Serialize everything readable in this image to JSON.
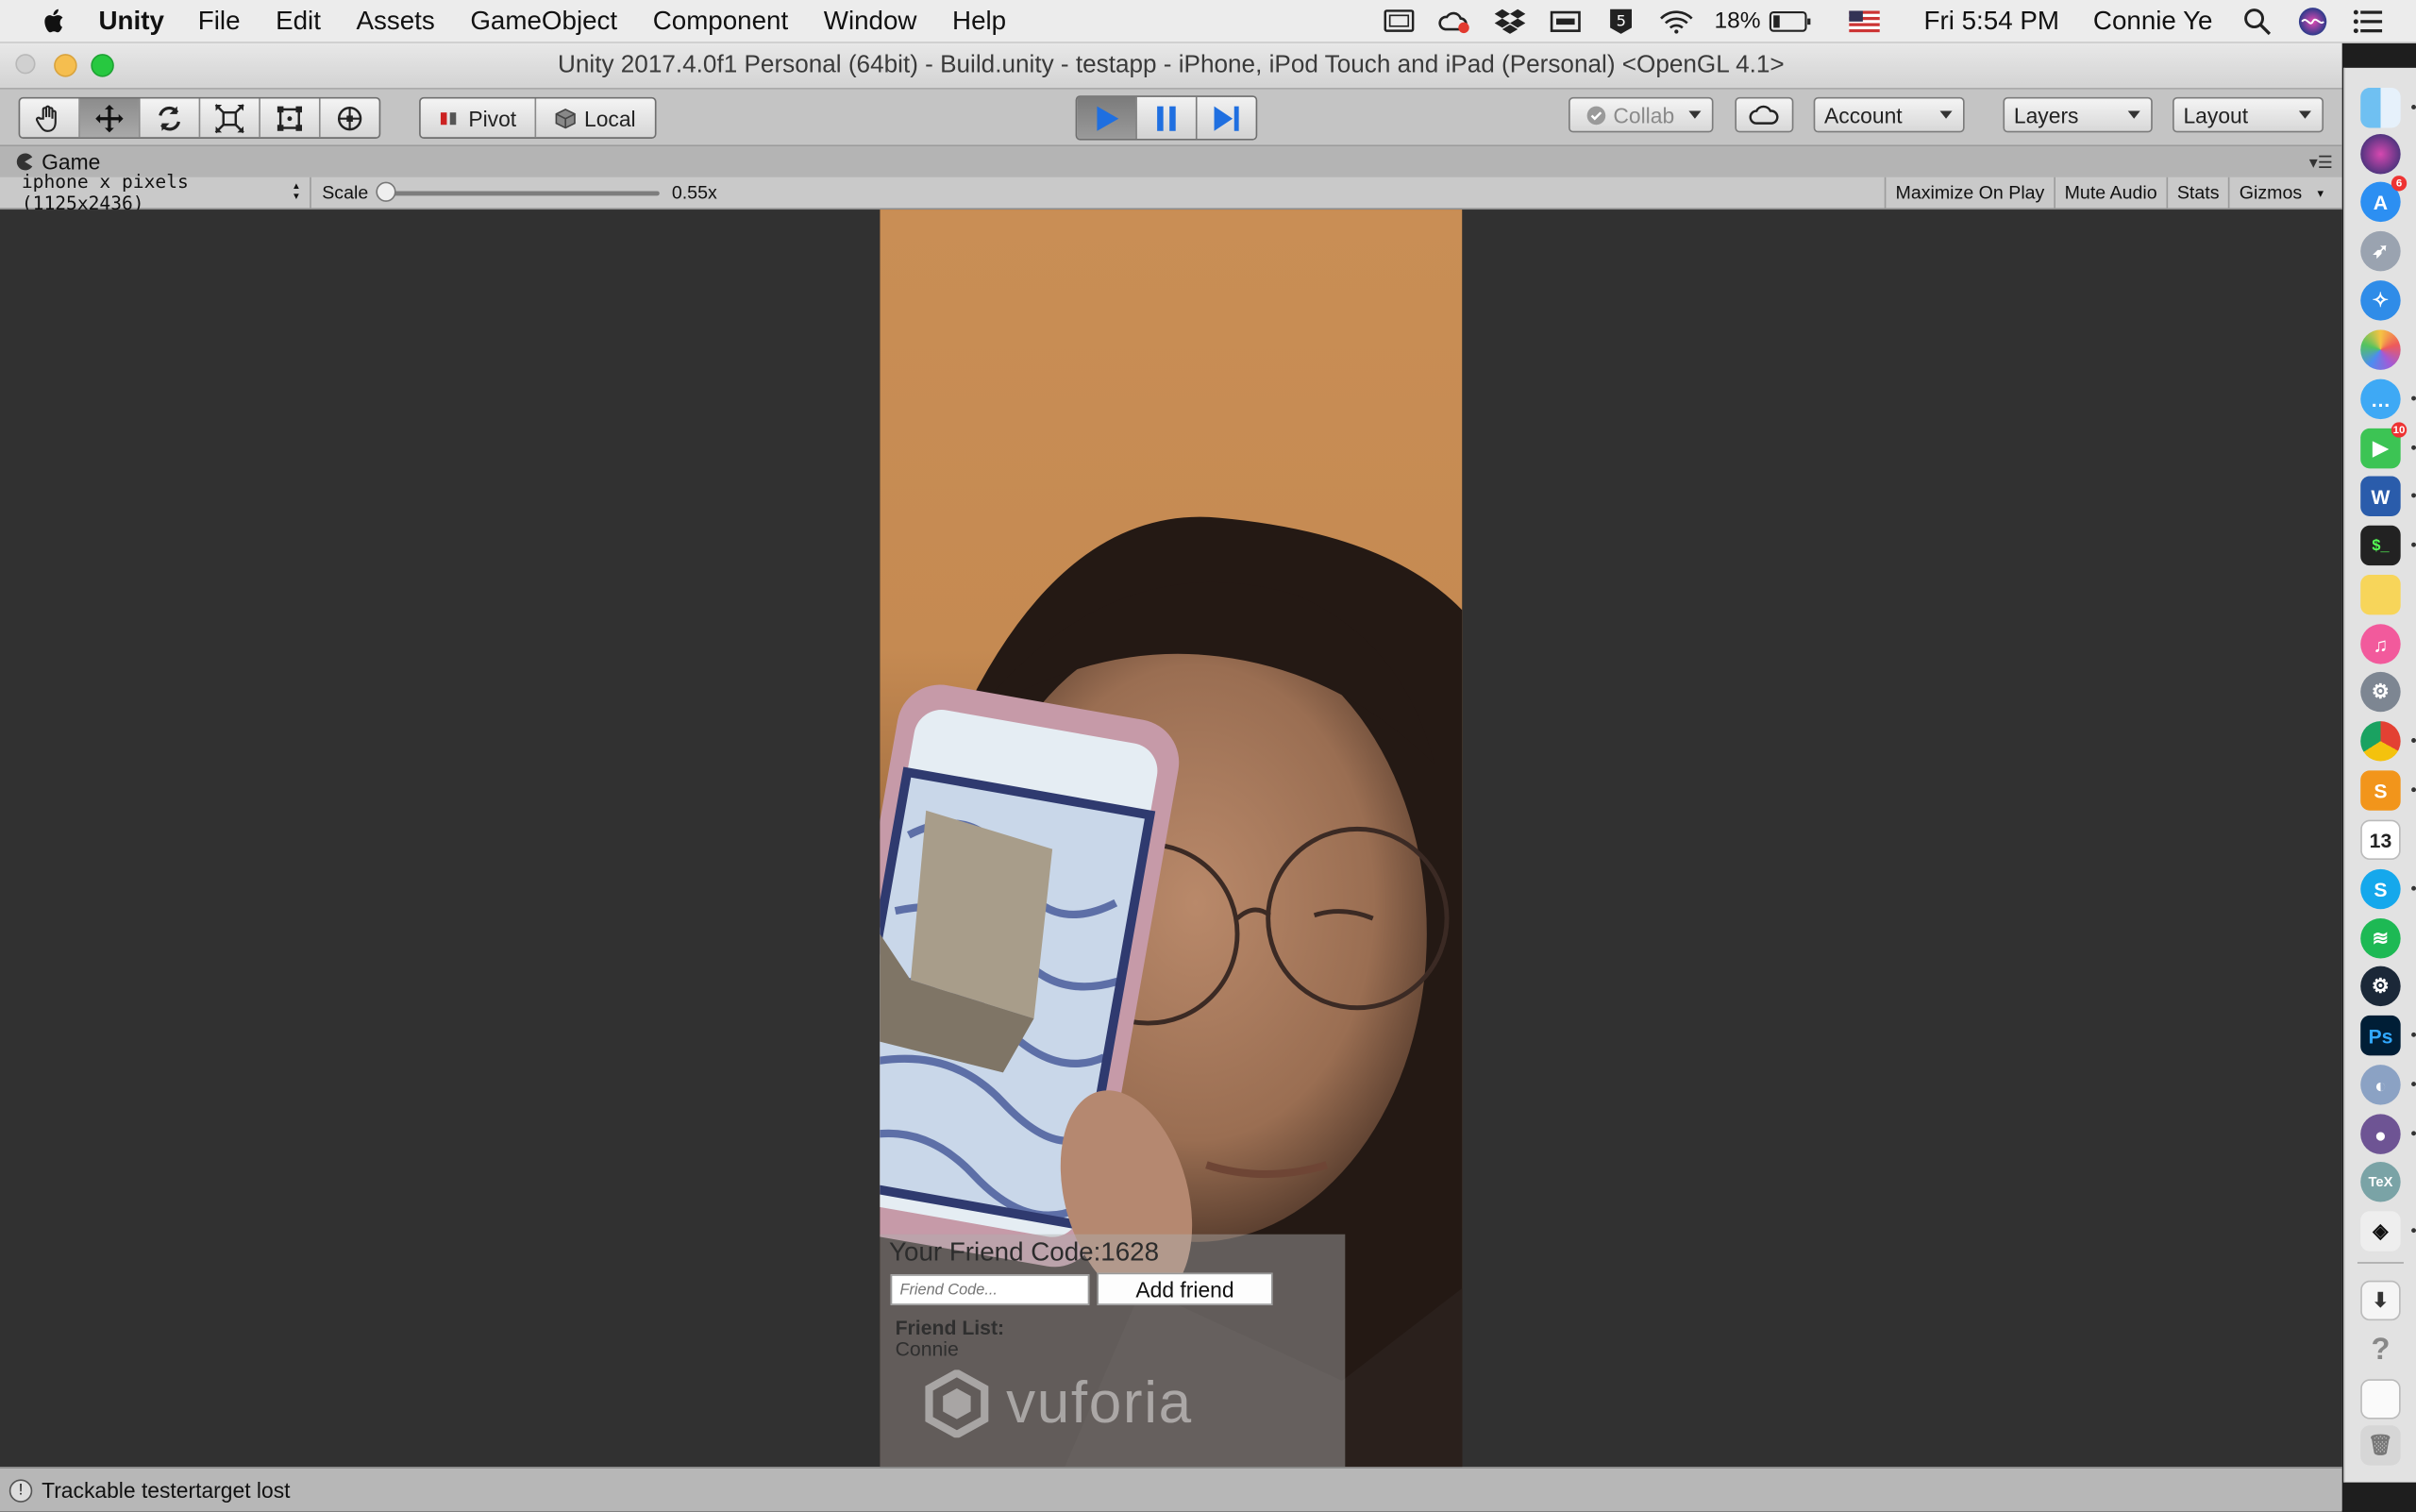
{
  "menubar": {
    "app_name": "Unity",
    "menus": [
      "File",
      "Edit",
      "Assets",
      "GameObject",
      "Component",
      "Window",
      "Help"
    ],
    "battery_pct": "18%",
    "clock": "Fri 5:54 PM",
    "user": "Connie Ye",
    "tray_icons": [
      "display-icon",
      "creative-cloud-icon",
      "dropbox-icon",
      "screen-icon",
      "scrobbler-icon",
      "wifi-icon",
      "battery-icon",
      "us-flag-icon"
    ]
  },
  "window": {
    "title": "Unity 2017.4.0f1 Personal (64bit) - Build.unity - testapp - iPhone, iPod Touch and iPad (Personal) <OpenGL 4.1>"
  },
  "toolbar": {
    "transform_tools": [
      "hand-tool",
      "move-tool",
      "rotate-tool",
      "scale-tool",
      "rect-tool",
      "transform-tool"
    ],
    "pivot_label": "Pivot",
    "local_label": "Local",
    "collab_label": "Collab",
    "account_label": "Account",
    "layers_label": "Layers",
    "layout_label": "Layout"
  },
  "game_view": {
    "tab_label": "Game",
    "resolution": "iphone x pixels (1125x2436)",
    "scale_label": "Scale",
    "scale_value": "0.55x",
    "scale_slider_fraction": 0.0,
    "toggles": {
      "maximize": "Maximize On Play",
      "mute": "Mute Audio",
      "stats": "Stats",
      "gizmos": "Gizmos"
    }
  },
  "app_ui": {
    "friend_code": "Your Friend Code:1628",
    "input_placeholder": "Friend Code...",
    "add_button": "Add friend",
    "friend_list_title": "Friend List:",
    "friends": [
      "Connie"
    ],
    "watermark": "vuforia"
  },
  "status": {
    "message": "Trackable testertarget lost"
  },
  "dock": {
    "items": [
      "finder",
      "siri",
      "app-store",
      "launchpad",
      "safari",
      "photos",
      "messages",
      "facetime",
      "word",
      "terminal",
      "notes",
      "itunes",
      "system-preferences",
      "chrome",
      "sublime-text",
      "calendar",
      "skype",
      "spotify",
      "steam",
      "photoshop",
      "network-utility",
      "github",
      "tex",
      "unity",
      "downloads",
      "help",
      "document",
      "trash"
    ],
    "calendar_day": "13",
    "badges": {
      "app_store": "6",
      "facetime": "10"
    }
  },
  "colors": {
    "play_active": "#1f6fe0",
    "menubar_bg": "#ececec",
    "viewport_bg": "#313131"
  }
}
